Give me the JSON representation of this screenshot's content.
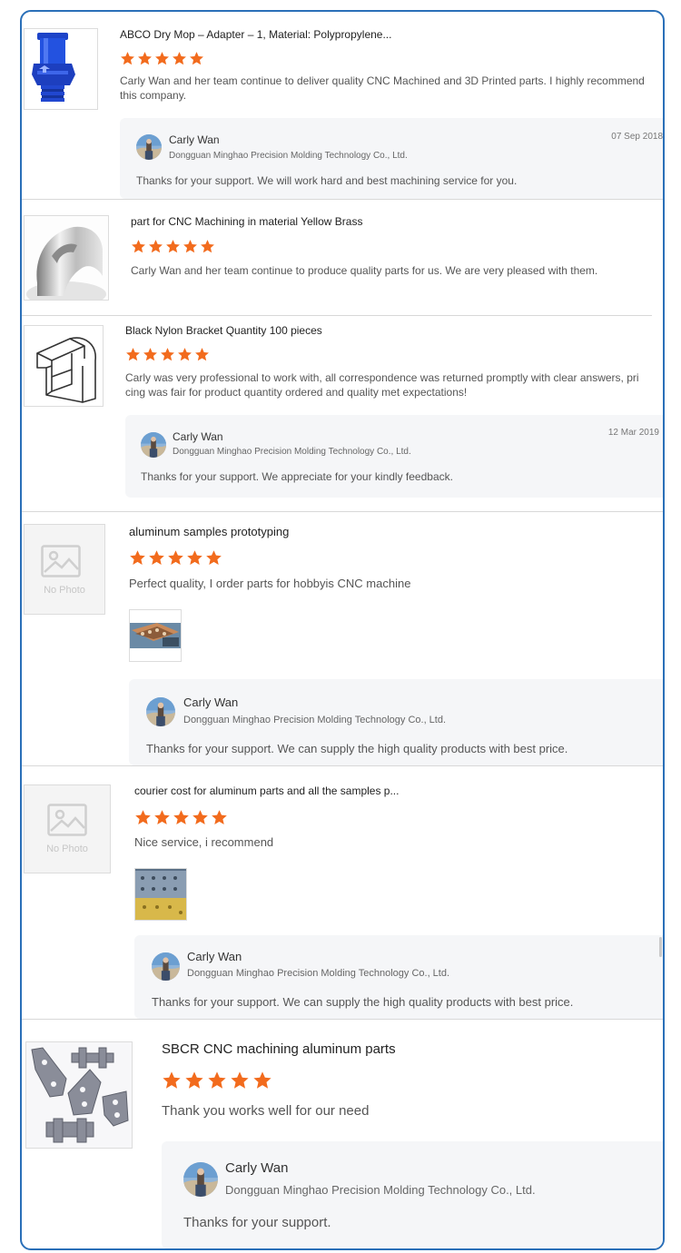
{
  "colors": {
    "frame_border": "#2a6fb8",
    "star": "#f26b1d",
    "reply_bg": "#f5f6f8"
  },
  "reviews": [
    {
      "title": "ABCO Dry Mop – Adapter – 1, Material: Polypropylene...",
      "rating": 5,
      "text": "Carly Wan and her team continue to deliver quality CNC Machined and 3D Printed parts. I highly recommend this company.",
      "image": "blue-adapter-icon",
      "reply": {
        "name": "Carly Wan",
        "company": "Dongguan Minghao Precision Molding Technology Co., Ltd.",
        "date": "07 Sep 2018",
        "text": "Thanks for your support. We will work hard and best machining service for you."
      }
    },
    {
      "title": "part for CNC Machining in material Yellow Brass",
      "rating": 5,
      "text": "Carly Wan and her team continue to produce quality parts for us. We are very pleased with them.",
      "image": "brass-clip-icon"
    },
    {
      "title": "Black Nylon Bracket Quantity 100 pieces",
      "rating": 5,
      "text": "Carly was very professional to work with, all correspondence was returned promptly with clear answers, pricing was fair for product quantity ordered and quality met expectations!",
      "image": "bracket-drawing-icon",
      "reply": {
        "name": "Carly Wan",
        "company": "Dongguan Minghao Precision Molding Technology Co., Ltd.",
        "date": "12 Mar 2019",
        "text": "Thanks for your support. We appreciate for your kindly feedback."
      }
    },
    {
      "title": "aluminum samples prototyping",
      "rating": 5,
      "text": "Perfect quality, I order parts for hobbyis CNC machine",
      "image": "no-photo-icon",
      "no_photo_label": "No Photo",
      "reply": {
        "name": "Carly Wan",
        "company": "Dongguan Minghao Precision Molding Technology Co., Ltd.",
        "text": "Thanks for your support. We can supply the high quality products with best price."
      }
    },
    {
      "title": "courier cost for aluminum parts and all the samples p...",
      "rating": 5,
      "text": "Nice service, i recommend",
      "image": "no-photo-icon",
      "no_photo_label": "No Photo",
      "reply": {
        "name": "Carly Wan",
        "company": "Dongguan Minghao Precision Molding Technology Co., Ltd.",
        "text": "Thanks for your support. We can supply the high quality products with best price."
      }
    },
    {
      "title": "SBCR CNC machining aluminum parts",
      "rating": 5,
      "text": "Thank you works well for our need",
      "image": "aluminum-parts-icon",
      "reply": {
        "name": "Carly Wan",
        "company": "Dongguan Minghao Precision Molding Technology Co., Ltd.",
        "text": "Thanks for your support."
      }
    }
  ]
}
